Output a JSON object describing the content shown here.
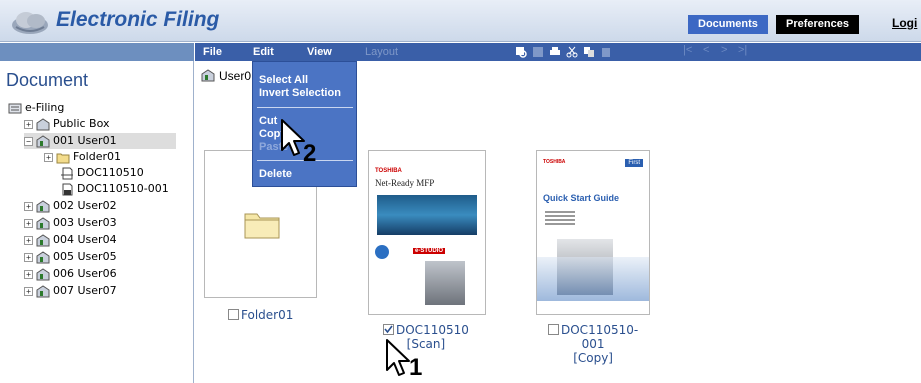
{
  "header": {
    "app_title": "Electronic Filing",
    "tabs": [
      "Documents",
      "Preferences"
    ],
    "login_label": "Logi"
  },
  "sidebar": {
    "title": "Document",
    "tree": [
      {
        "label": "e-Filing"
      },
      {
        "label": "Public Box"
      },
      {
        "label": "001 User01"
      },
      {
        "label": "Folder01"
      },
      {
        "label": "DOC110510"
      },
      {
        "label": "DOC110510-001"
      },
      {
        "label": "002 User02"
      },
      {
        "label": "003 User03"
      },
      {
        "label": "004 User04"
      },
      {
        "label": "005 User05"
      },
      {
        "label": "006 User06"
      },
      {
        "label": "007 User07"
      }
    ]
  },
  "menubar": {
    "items": [
      "File",
      "Edit",
      "View",
      "Layout"
    ],
    "nav_arrows": [
      "|<",
      "<",
      ">",
      ">|"
    ]
  },
  "content": {
    "path_label": "User0"
  },
  "context_menu": {
    "items": [
      "Select All",
      "Invert Selection",
      "Cut",
      "Copy",
      "Paste",
      "Delete"
    ]
  },
  "thumbnails": [
    {
      "name": "Folder01",
      "subtitle": "",
      "checked": false
    },
    {
      "name": "DOC110510",
      "subtitle": "[Scan]",
      "checked": true
    },
    {
      "name": "DOC110510-",
      "name_line2": "001",
      "subtitle": "[Copy]",
      "checked": false
    }
  ],
  "doc_preview_1": {
    "brand": "TOSHIBA",
    "title": "Net-Ready MFP",
    "studio": "e-STUDIO"
  },
  "doc_preview_2": {
    "brand": "TOSHIBA",
    "badge": "First",
    "title": "Quick Start Guide"
  },
  "callouts": [
    "1",
    "2"
  ],
  "colors": {
    "menubar": "#3a5fa8",
    "dropdown": "#4b74c4",
    "title": "#2a5aa6",
    "link": "#2a4f8e"
  }
}
